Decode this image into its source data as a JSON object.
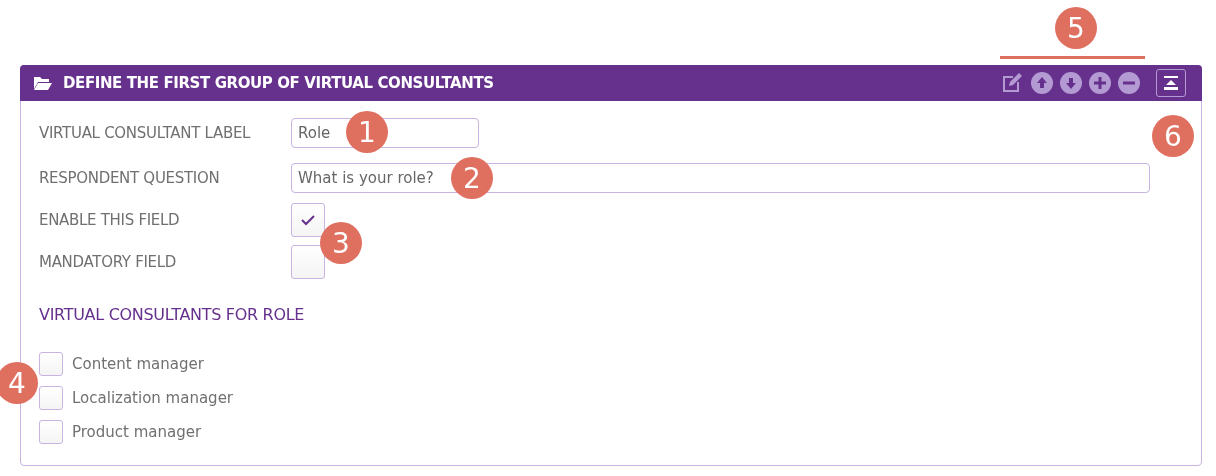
{
  "panel": {
    "title": "DEFINE THE FIRST GROUP OF VIRTUAL CONSULTANTS",
    "tools": [
      {
        "kind": "edit"
      },
      {
        "kind": "up"
      },
      {
        "kind": "down"
      },
      {
        "kind": "add"
      },
      {
        "kind": "remove"
      }
    ],
    "fields": [
      {
        "kind": "text",
        "label": "VIRTUAL CONSULTANT LABEL",
        "value": "Role"
      },
      {
        "kind": "text",
        "label": "RESPONDENT QUESTION",
        "value": "What is your role?"
      },
      {
        "kind": "checkbox",
        "label": "ENABLE THIS FIELD",
        "checked": true
      },
      {
        "kind": "checkbox",
        "label": "MANDATORY FIELD",
        "checked": false
      }
    ],
    "section_title": "VIRTUAL CONSULTANTS FOR ROLE",
    "options": [
      {
        "label": "Content manager",
        "checked": false
      },
      {
        "label": "Localization manager",
        "checked": false
      },
      {
        "label": "Product manager",
        "checked": false
      }
    ]
  },
  "callouts": [
    {
      "number": "1"
    },
    {
      "number": "2"
    },
    {
      "number": "3"
    },
    {
      "number": "4"
    },
    {
      "number": "5"
    },
    {
      "number": "6"
    }
  ]
}
